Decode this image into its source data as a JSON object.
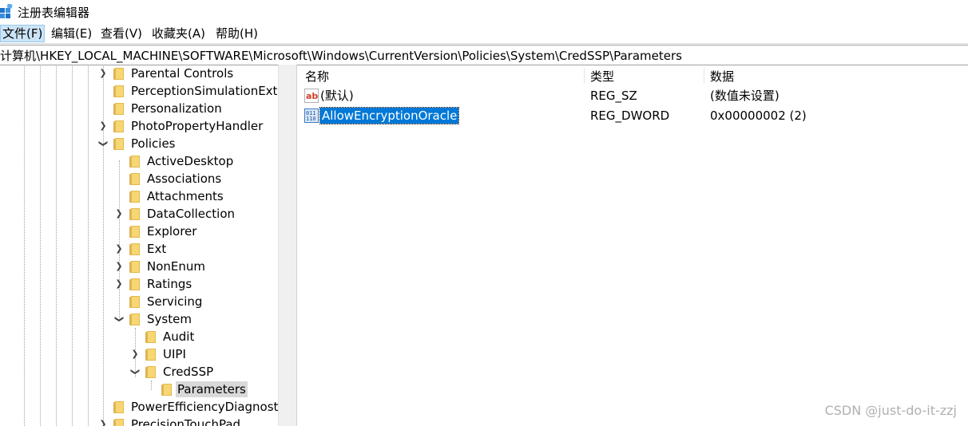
{
  "window": {
    "title": "注册表编辑器"
  },
  "menu": [
    "文件(F)",
    "编辑(E)",
    "查看(V)",
    "收藏夹(A)",
    "帮助(H)"
  ],
  "address": "计算机\\HKEY_LOCAL_MACHINE\\SOFTWARE\\Microsoft\\Windows\\CurrentVersion\\Policies\\System\\CredSSP\\Parameters",
  "tree": [
    {
      "label": "Parental Controls",
      "expander": "collapsed"
    },
    {
      "label": "PerceptionSimulationExte",
      "expander": "none"
    },
    {
      "label": "Personalization",
      "expander": "none"
    },
    {
      "label": "PhotoPropertyHandler",
      "expander": "collapsed"
    },
    {
      "label": "Policies",
      "expander": "expanded"
    },
    {
      "label": "ActiveDesktop",
      "expander": "none"
    },
    {
      "label": "Associations",
      "expander": "none"
    },
    {
      "label": "Attachments",
      "expander": "none"
    },
    {
      "label": "DataCollection",
      "expander": "collapsed"
    },
    {
      "label": "Explorer",
      "expander": "none"
    },
    {
      "label": "Ext",
      "expander": "collapsed"
    },
    {
      "label": "NonEnum",
      "expander": "collapsed"
    },
    {
      "label": "Ratings",
      "expander": "collapsed"
    },
    {
      "label": "Servicing",
      "expander": "none"
    },
    {
      "label": "System",
      "expander": "expanded"
    },
    {
      "label": "Audit",
      "expander": "none"
    },
    {
      "label": "UIPI",
      "expander": "collapsed"
    },
    {
      "label": "CredSSP",
      "expander": "expanded"
    },
    {
      "label": "Parameters",
      "expander": "none",
      "selected": true
    },
    {
      "label": "PowerEfficiencyDiagnosti",
      "expander": "none"
    },
    {
      "label": "PrecisionTouchPad",
      "expander": "collapsed"
    }
  ],
  "list": {
    "headers": {
      "name": "名称",
      "type": "类型",
      "data": "数据"
    },
    "rows": [
      {
        "icon": "string-value-icon",
        "name": "(默认)",
        "type": "REG_SZ",
        "data": "(数值未设置)"
      },
      {
        "icon": "dword-value-icon",
        "name": "AllowEncryptionOracle",
        "type": "REG_DWORD",
        "data": "0x00000002 (2)",
        "selected": true
      }
    ]
  },
  "watermark": "CSDN @just-do-it-zzj"
}
